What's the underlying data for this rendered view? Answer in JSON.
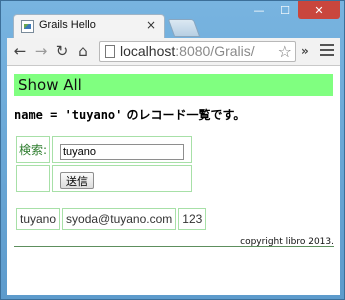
{
  "browser": {
    "tab_title": "Grails Hello",
    "tab_close": "×",
    "url_host": "localhost",
    "url_rest": ":8080/Gralis/",
    "window_controls": {
      "minimize": "—",
      "maximize": "☐",
      "close": "✕"
    }
  },
  "page": {
    "header": "Show All",
    "description_prefix": "name = 'tuyano'",
    "description_suffix": " のレコード一覧です。",
    "search": {
      "label": "検索:",
      "input_value": "tuyano",
      "submit_label": "送信"
    },
    "results": [
      {
        "name": "tuyano",
        "email": "syoda@tuyano.com",
        "number": "123"
      }
    ],
    "copyright": "copyright libro 2013."
  },
  "colors": {
    "header_bg": "#80ff80",
    "cell_border": "#a7e0a7",
    "label_text": "#2e7d2e"
  }
}
